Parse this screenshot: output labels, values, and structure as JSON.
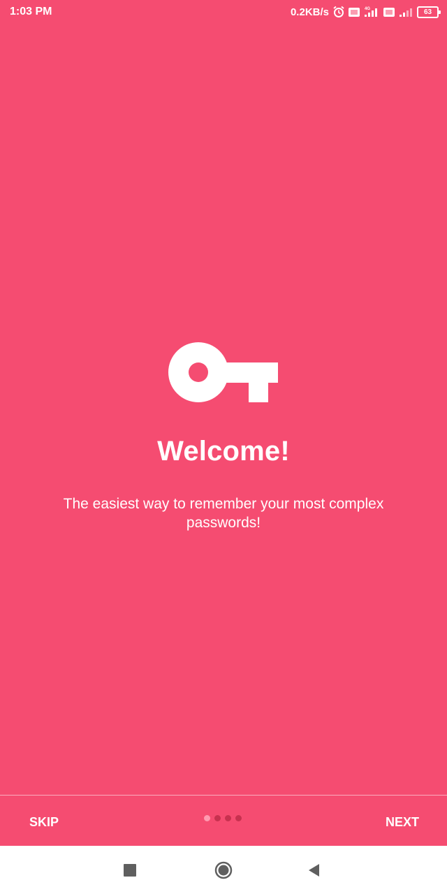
{
  "status_bar": {
    "time": "1:03 PM",
    "net_speed": "0.2KB/s",
    "battery_level": "63",
    "icons": [
      "alarm-icon",
      "volte-icon",
      "signal-4g-icon",
      "volte-icon",
      "signal-icon",
      "battery-icon"
    ]
  },
  "onboarding": {
    "icon": "key-icon",
    "title": "Welcome!",
    "description": "The easiest way to remember your most complex passwords!",
    "page_count": 4,
    "current_page": 1
  },
  "bottom_bar": {
    "skip_label": "SKIP",
    "next_label": "NEXT"
  },
  "nav_bar": {
    "icons": [
      "recents-icon",
      "home-icon",
      "back-icon"
    ]
  },
  "colors": {
    "background": "#f54c71",
    "text": "#ffffff",
    "dot_inactive": "#c7314f",
    "dot_active": "#ff9ab0",
    "nav_bar": "#ffffff"
  }
}
